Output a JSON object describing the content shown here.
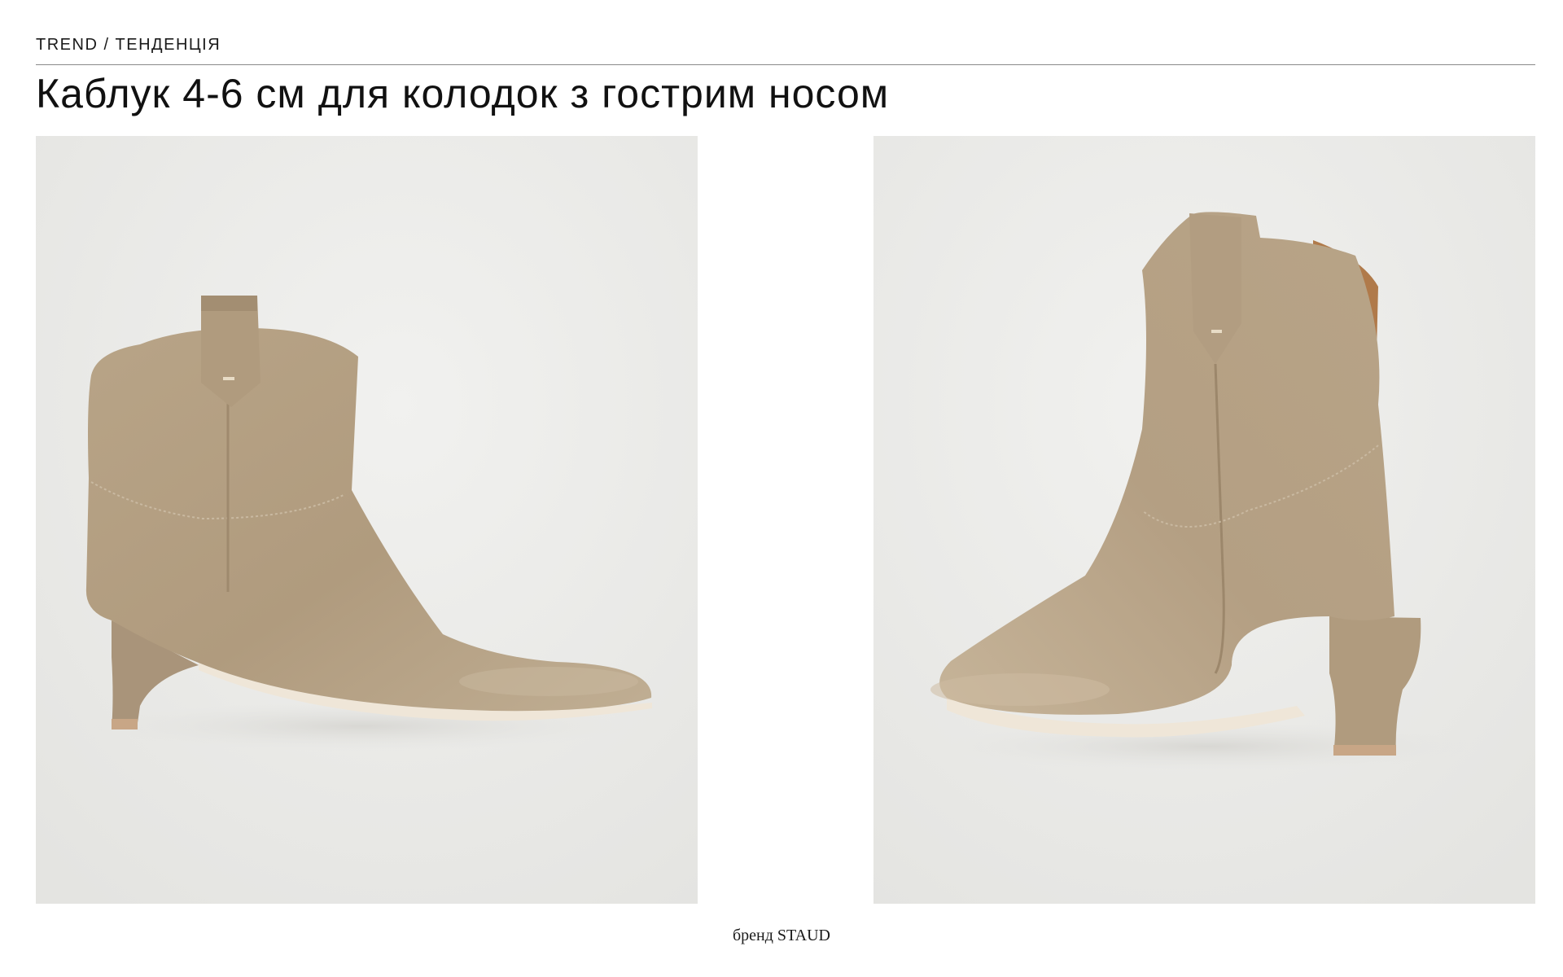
{
  "header": {
    "kicker": "TREND / ТЕНДЕНЦІЯ",
    "title": "Каблук 4-6 см для колодок з гострим носом"
  },
  "photos": [
    {
      "subject": "suede-ankle-boot-side-view",
      "background": "#ececea",
      "suede": "#b9a68b"
    },
    {
      "subject": "suede-ankle-boot-back-view",
      "background": "#ececea",
      "suede": "#bfac91"
    }
  ],
  "caption": "бренд STAUD",
  "colors": {
    "rule": "#8a8a8a",
    "text": "#111111"
  }
}
